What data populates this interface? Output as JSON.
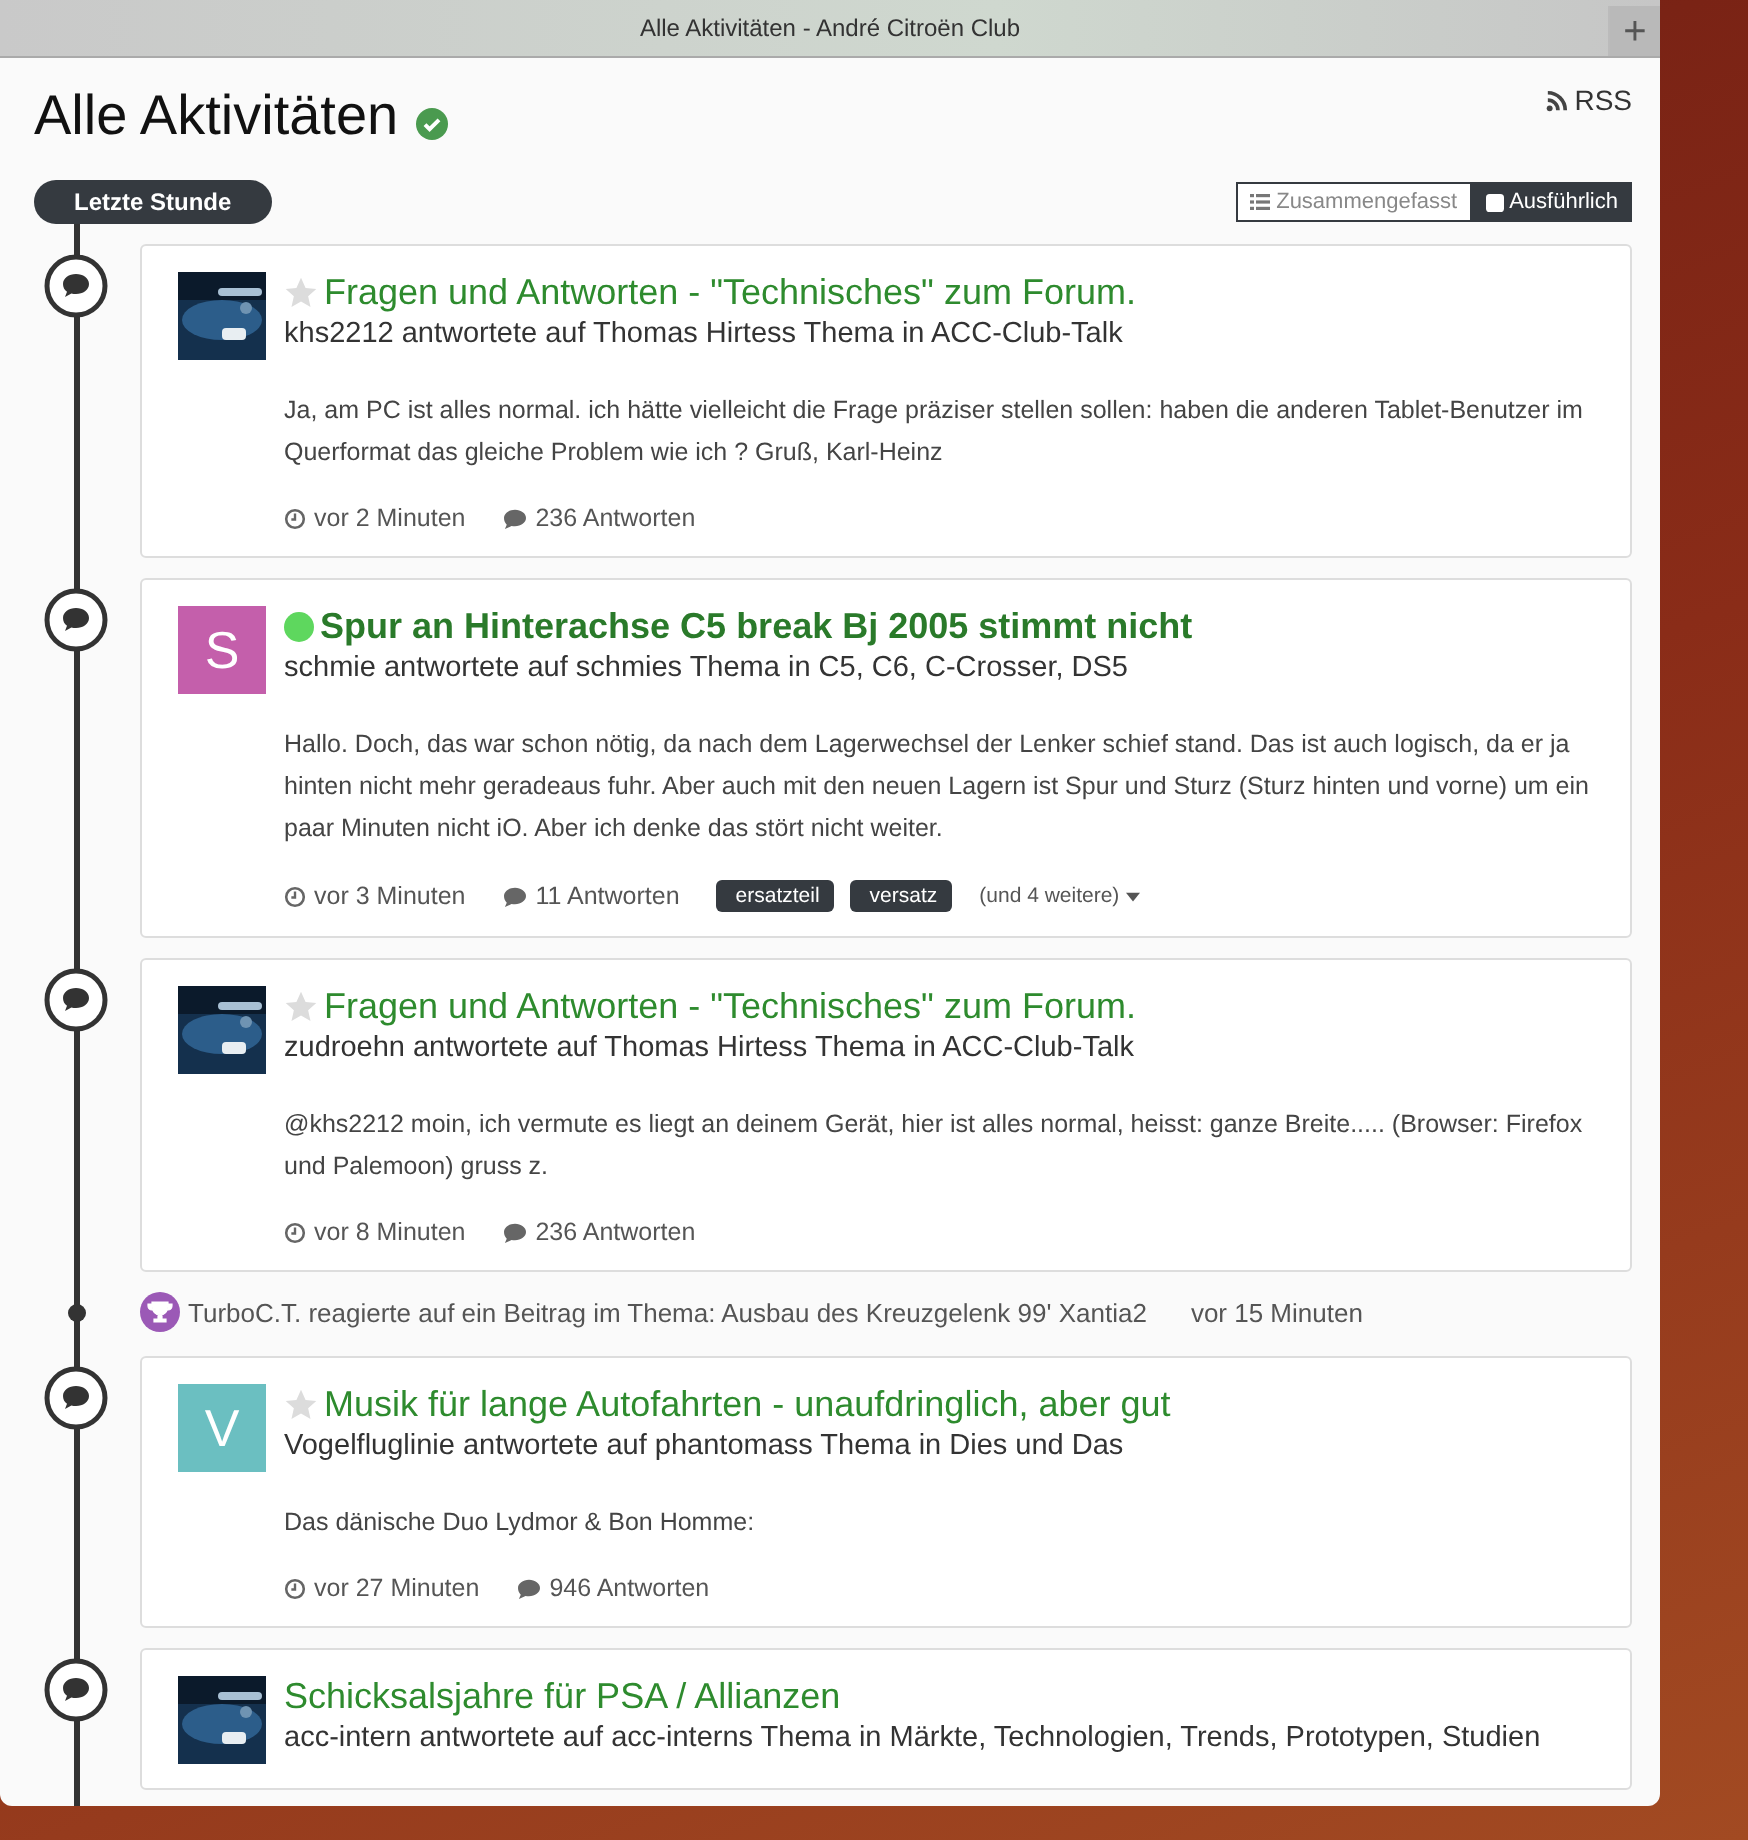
{
  "window": {
    "title": "Alle Aktivitäten - André Citroën Club",
    "new_tab": "+"
  },
  "page": {
    "title": "Alle Aktivitäten",
    "verified": true,
    "rss": "RSS"
  },
  "period": "Letzte Stunde",
  "views": [
    {
      "label": "Zusammengefasst",
      "selected": false
    },
    {
      "label": "Ausführlich",
      "selected": true
    }
  ],
  "items": [
    {
      "kind": "post",
      "unread": false,
      "title": "Fragen und Antworten - \"Technisches\" zum Forum.",
      "subtitle": "khs2212 antwortete auf Thomas Hirtess Thema in ACC-Club-Talk",
      "body": "Ja, am PC ist alles normal. ich hätte vielleicht die Frage präziser stellen sollen: haben die anderen Tablet-Benutzer im Querformat das gleiche Problem wie ich ? Gruß, Karl-Heinz",
      "time": "vor 2 Minuten",
      "replies": "236 Antworten"
    },
    {
      "kind": "post",
      "avatar": {
        "kind": "letter",
        "letter": "S",
        "color": "#c45fab"
      },
      "unread": true,
      "title": "Spur an Hinterachse C5 break Bj 2005 stimmt nicht",
      "subtitle": "schmie antwortete auf schmies Thema in C5, C6, C-Crosser, DS5",
      "body": "Hallo. Doch, das war schon nötig, da nach dem Lagerwechsel der Lenker schief stand. Das ist auch logisch, da er ja hinten nicht mehr geradeaus fuhr. Aber auch mit den neuen Lagern ist Spur und Sturz (Sturz hinten und vorne) um ein paar Minuten nicht iO. Aber ich denke das stört nicht weiter.",
      "time": "vor 3 Minuten",
      "replies": "11 Antworten",
      "tags": [
        "ersatzteil",
        "versatz"
      ],
      "more_tags": "(und 4 weitere)"
    },
    {
      "kind": "post",
      "unread": false,
      "title": "Fragen und Antworten - \"Technisches\" zum Forum.",
      "subtitle": "zudroehn antwortete auf Thomas Hirtess Thema in ACC-Club-Talk",
      "body": "@khs2212 moin, ich vermute es liegt an deinem Gerät, hier ist alles normal, heisst: ganze Breite..... (Browser: Firefox und Palemoon) gruss z.",
      "time": "vor 8 Minuten",
      "replies": "236 Antworten"
    },
    {
      "kind": "reaction",
      "text": "TurboC.T. reagierte auf ein Beitrag im Thema: Ausbau des Kreuzgelenk 99' Xantia2",
      "time": "vor 15 Minuten"
    },
    {
      "kind": "post",
      "avatar": {
        "kind": "letter",
        "letter": "V",
        "color": "#6bbfc1"
      },
      "unread": false,
      "title": "Musik für lange Autofahrten - unaufdringlich, aber gut",
      "subtitle": "Vogelfluglinie antwortete auf phantomass Thema in Dies und Das",
      "body": "Das dänische Duo Lydmor & Bon Homme:",
      "time": "vor 27 Minuten",
      "replies": "946 Antworten"
    },
    {
      "kind": "post",
      "title": "Schicksalsjahre für PSA / Allianzen",
      "subtitle": "acc-intern antwortete auf acc-interns Thema in Märkte, Technologien, Trends, Prototypen, Studien"
    }
  ]
}
